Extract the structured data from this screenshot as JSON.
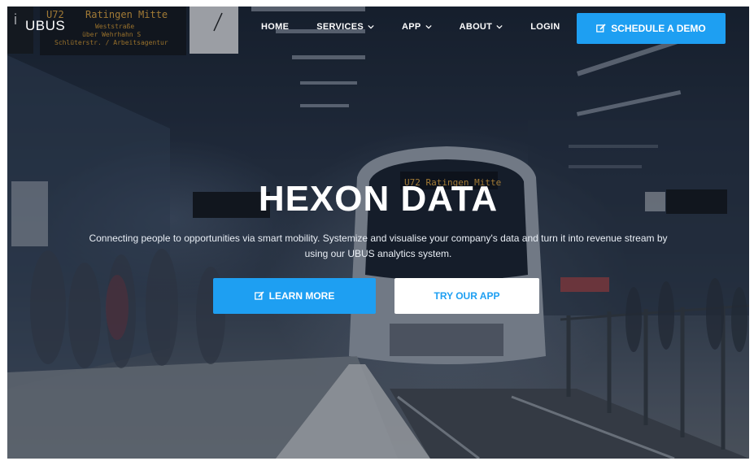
{
  "brand": {
    "name": "UBUS"
  },
  "nav": {
    "items": [
      {
        "label": "HOME",
        "dropdown": false
      },
      {
        "label": "SERVICES",
        "dropdown": true
      },
      {
        "label": "APP",
        "dropdown": true
      },
      {
        "label": "ABOUT",
        "dropdown": true
      },
      {
        "label": "LOGIN",
        "dropdown": false
      }
    ],
    "cta_label": "SCHEDULE A DEMO",
    "cta_icon": "edit-icon"
  },
  "hero": {
    "title": "HEXON DATA",
    "subtitle": "Connecting people to opportunities via smart mobility. Systemize and visualise your company's data and turn it into revenue stream by using our UBUS analytics system.",
    "primary_button": "LEARN MORE",
    "primary_icon": "edit-icon",
    "secondary_button": "TRY OUR APP"
  },
  "scene_signs": {
    "top_left_line": "U72",
    "top_left_dest": "Ratingen Mitte",
    "top_left_l2": "Weststraße",
    "top_left_l3": "über Wehrhahn S",
    "top_left_l4": "Schlüterstr. / Arbeitsagentur",
    "train_sign": "U72 Ratingen Mitte"
  },
  "colors": {
    "accent": "#1e9ff2",
    "text_light": "#ffffff"
  }
}
